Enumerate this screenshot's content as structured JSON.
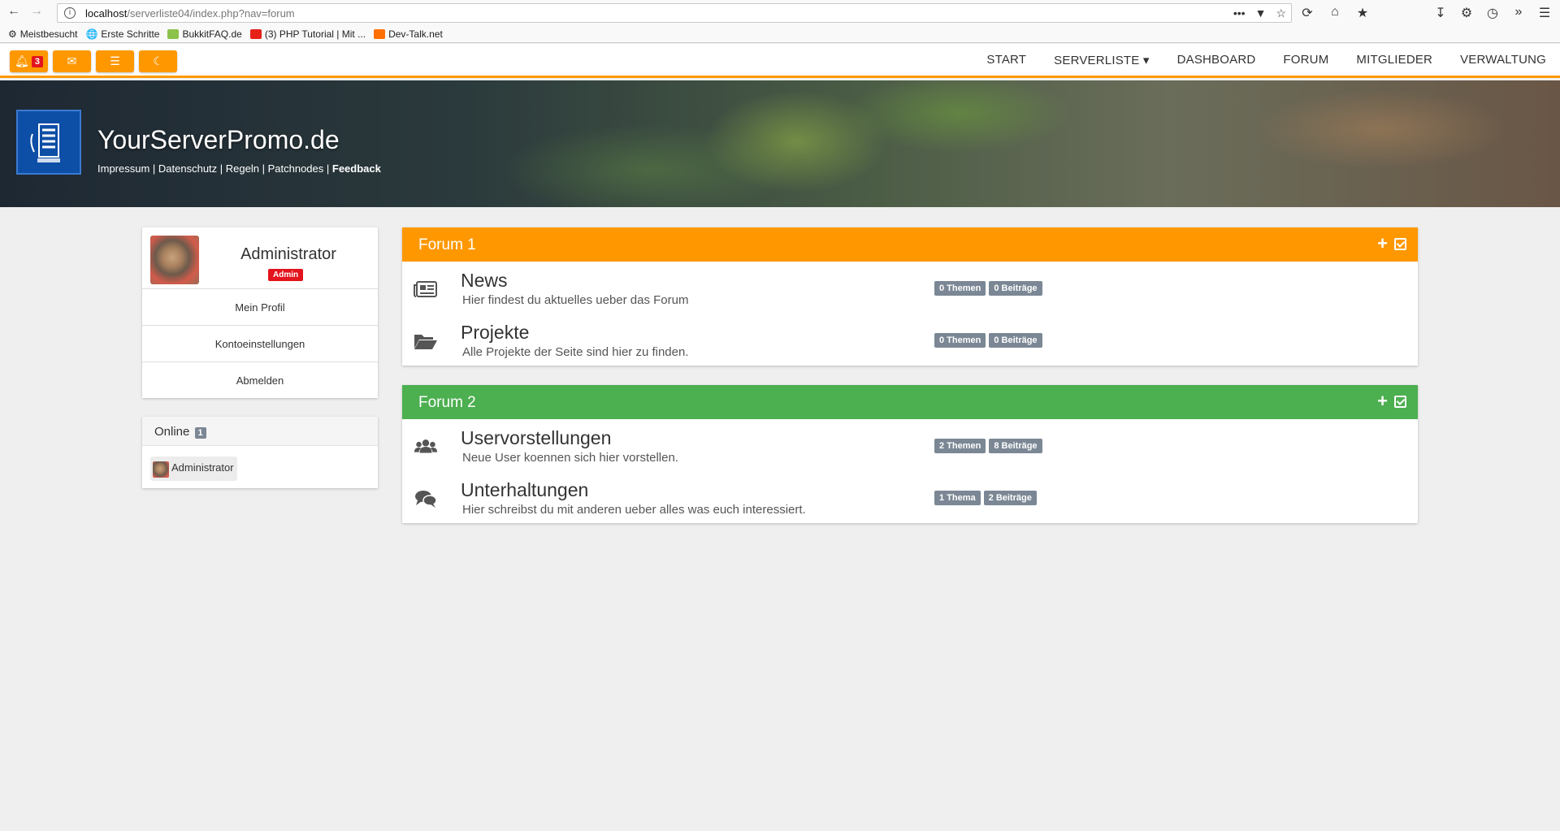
{
  "browser": {
    "url_host": "localhost",
    "url_path": "/serverliste04/index.php?nav=forum",
    "bookmarks": [
      "Meistbesucht",
      "Erste Schritte",
      "BukkitFAQ.de",
      "(3) PHP Tutorial | Mit ...",
      "Dev-Talk.net"
    ]
  },
  "nav": {
    "notification_count": "3",
    "menu": [
      "START",
      "SERVERLISTE ▾",
      "DASHBOARD",
      "FORUM",
      "MITGLIEDER",
      "VERWALTUNG"
    ]
  },
  "site": {
    "title": "YourServerPromo.de",
    "links": [
      "Impressum",
      "Datenschutz",
      "Regeln",
      "Patchnodes",
      "Feedback"
    ]
  },
  "profile": {
    "name": "Administrator",
    "role": "Admin",
    "links": [
      "Mein Profil",
      "Kontoeinstellungen",
      "Abmelden"
    ]
  },
  "online": {
    "label": "Online",
    "count": "1",
    "users": [
      "Administrator"
    ]
  },
  "forums": [
    {
      "title": "Forum 1",
      "boards": [
        {
          "title": "News",
          "desc": "Hier findest du aktuelles ueber das Forum",
          "topics": "0 Themen",
          "posts": "0 Beiträge",
          "icon": "newspaper-icon"
        },
        {
          "title": "Projekte",
          "desc": "Alle Projekte der Seite sind hier zu finden.",
          "topics": "0 Themen",
          "posts": "0 Beiträge",
          "icon": "folder-open-icon"
        }
      ]
    },
    {
      "title": "Forum 2",
      "boards": [
        {
          "title": "Uservorstellungen",
          "desc": "Neue User koennen sich hier vorstellen.",
          "topics": "2 Themen",
          "posts": "8 Beiträge",
          "icon": "users-icon"
        },
        {
          "title": "Unterhaltungen",
          "desc": "Hier schreibst du mit anderen ueber alles was euch interessiert.",
          "topics": "1 Thema",
          "posts": "2 Beiträge",
          "icon": "comments-icon"
        }
      ]
    }
  ],
  "colors": {
    "accent": "#ff9800",
    "forum2": "#4caf50",
    "badge_red": "#e3141d",
    "badge_gray": "#7b8794"
  }
}
